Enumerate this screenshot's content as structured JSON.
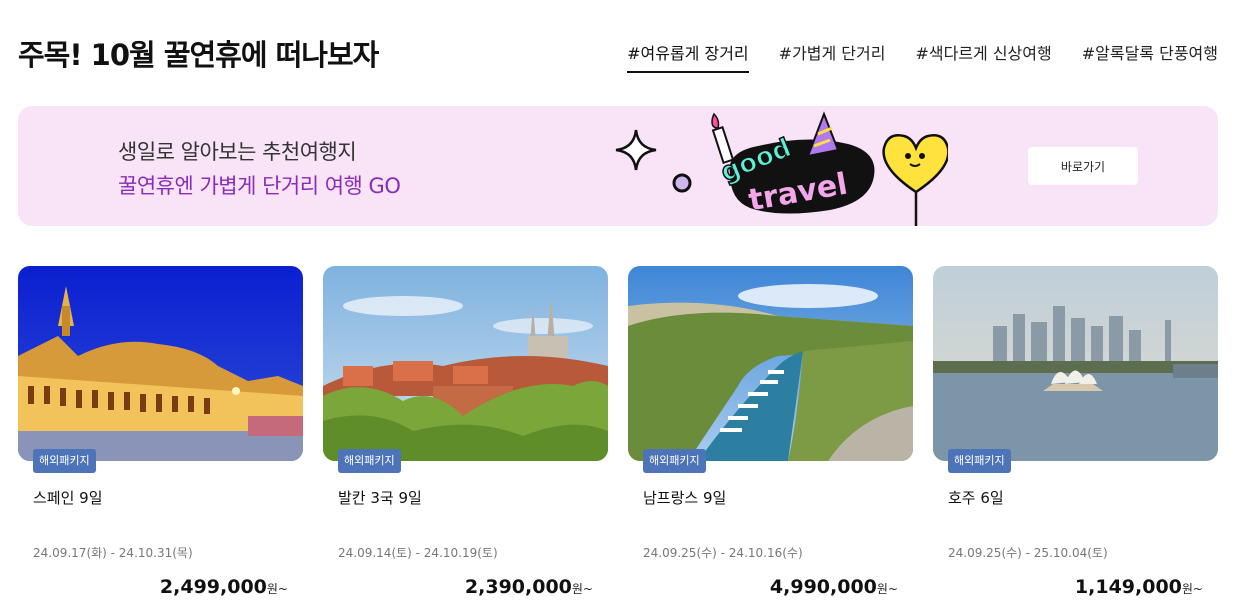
{
  "header": {
    "title": "주목! 10월 꿀연휴에 떠나보자",
    "tabs": [
      "#여유롭게 장거리",
      "#가볍게 단거리",
      "#색다르게 신상여행",
      "#알록달록 단풍여행"
    ]
  },
  "banner": {
    "line1": "생일로 알아보는 추천여행지",
    "line2": "꿀연휴엔 가볍게 단거리 여행 GO",
    "logo_text": [
      "good",
      "travel"
    ],
    "button_label": "바로가기",
    "background_color": "#f9e4f7",
    "accent_color": "#8a2cb8"
  },
  "cards": [
    {
      "badge": "해외패키지",
      "title": "스페인 9일",
      "dates": "24.09.17(화) - 24.10.31(목)",
      "price": "2,499,000",
      "unit": "원~"
    },
    {
      "badge": "해외패키지",
      "title": "발칸 3국 9일",
      "dates": "24.09.14(토) - 24.10.19(토)",
      "price": "2,390,000",
      "unit": "원~"
    },
    {
      "badge": "해외패키지",
      "title": "남프랑스 9일",
      "dates": "24.09.25(수) - 24.10.16(수)",
      "price": "4,990,000",
      "unit": "원~"
    },
    {
      "badge": "해외패키지",
      "title": "호주 6일",
      "dates": "24.09.25(수) - 25.10.04(토)",
      "price": "1,149,000",
      "unit": "원~"
    }
  ],
  "colors": {
    "badge": "#4d73b8",
    "text": "#111111",
    "muted": "#777777"
  }
}
